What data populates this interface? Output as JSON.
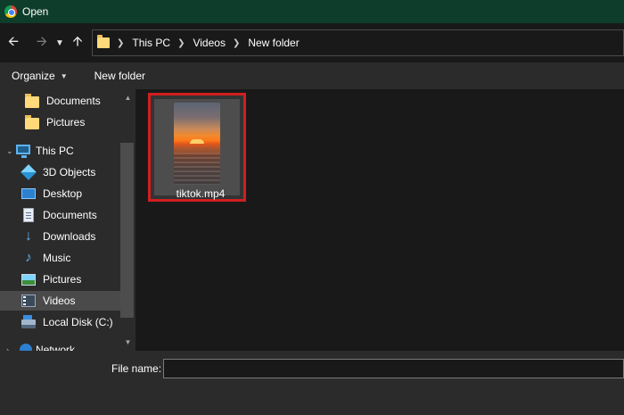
{
  "window": {
    "title": "Open",
    "app_icon": "chrome-icon"
  },
  "navigation": {
    "back_icon": "arrow-left-icon",
    "forward_icon": "arrow-right-icon",
    "recent_icon": "chevron-down-icon",
    "up_icon": "arrow-up-icon",
    "breadcrumb": [
      "This PC",
      "Videos",
      "New folder"
    ]
  },
  "toolbar": {
    "organize_label": "Organize",
    "new_folder_label": "New folder"
  },
  "sidebar": {
    "items": [
      {
        "label": "Documents",
        "icon": "folder-icon"
      },
      {
        "label": "Pictures",
        "icon": "folder-icon"
      },
      {
        "label": "This PC",
        "icon": "computer-icon"
      },
      {
        "label": "3D Objects",
        "icon": "cube-icon"
      },
      {
        "label": "Desktop",
        "icon": "desktop-icon"
      },
      {
        "label": "Documents",
        "icon": "document-icon"
      },
      {
        "label": "Downloads",
        "icon": "download-icon"
      },
      {
        "label": "Music",
        "icon": "music-note-icon"
      },
      {
        "label": "Pictures",
        "icon": "picture-icon"
      },
      {
        "label": "Videos",
        "icon": "video-icon",
        "selected": true
      },
      {
        "label": "Local Disk (C:)",
        "icon": "disk-icon"
      },
      {
        "label": "Network",
        "icon": "network-icon"
      }
    ]
  },
  "files": [
    {
      "name": "tiktok.mp4",
      "selected": true,
      "highlight_color": "#d11f1f"
    }
  ],
  "footer": {
    "file_name_label": "File name:",
    "file_name_value": ""
  },
  "colors": {
    "titlebar": "#0f3d2b",
    "pane": "#2b2b2b",
    "background": "#191919",
    "selection": "#4a4a4a"
  }
}
